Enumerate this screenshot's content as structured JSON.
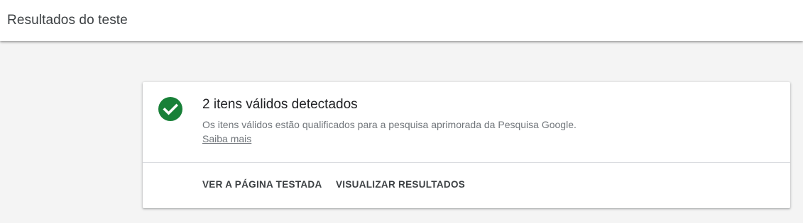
{
  "header": {
    "title": "Resultados do teste"
  },
  "result_card": {
    "status_icon": "check-circle-icon",
    "status_color": "#188038",
    "heading": "2 itens válidos detectados",
    "description": "Os itens válidos estão qualificados para a pesquisa aprimorada da Pesquisa Google.",
    "learn_more": "Saiba mais",
    "actions": {
      "view_page": "VER A PÁGINA TESTADA",
      "view_results": "VISUALIZAR RESULTADOS"
    }
  }
}
